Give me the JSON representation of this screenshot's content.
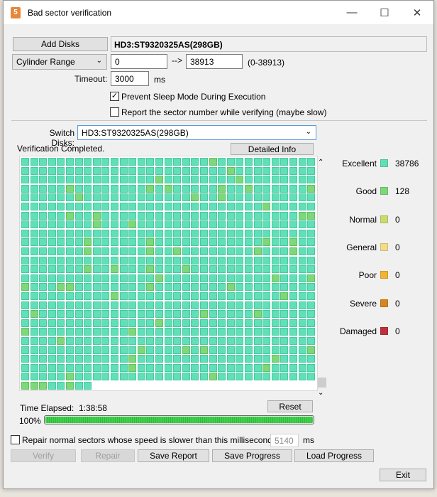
{
  "window": {
    "title": "Bad sector verification"
  },
  "top": {
    "add_disks": "Add Disks",
    "disk_name": "HD3:ST9320325AS(298GB)",
    "range_mode": "Cylinder Range",
    "range_from": "0",
    "arrow": "-->",
    "range_to": "38913",
    "range_hint": "(0-38913)",
    "timeout_label": "Timeout:",
    "timeout_value": "3000",
    "timeout_unit": "ms",
    "prevent_sleep": "Prevent Sleep Mode During Execution",
    "prevent_sleep_checked": true,
    "report_sector": "Report the sector number while verifying (maybe slow)",
    "report_sector_checked": false
  },
  "main": {
    "switch_label": "Switch Disks:",
    "switch_value": "HD3:ST9320325AS(298GB)",
    "status": "Verification Completed.",
    "detailed_info": "Detailed Info",
    "time_label": "Time Elapsed:",
    "time_value": "1:38:58",
    "reset": "Reset",
    "progress_text": "100%",
    "progress": 100
  },
  "legend": [
    {
      "label": "Excellent",
      "color": "#5fe0b8",
      "count": "38786"
    },
    {
      "label": "Good",
      "color": "#7cd87a",
      "count": "128"
    },
    {
      "label": "Normal",
      "color": "#c8dc6e",
      "count": "0"
    },
    {
      "label": "General",
      "color": "#f2dc8a",
      "count": "0"
    },
    {
      "label": "Poor",
      "color": "#f2b430",
      "count": "0"
    },
    {
      "label": "Severe",
      "color": "#d8861c",
      "count": "0"
    },
    {
      "label": "Damaged",
      "color": "#c0303a",
      "count": "0"
    }
  ],
  "bottom": {
    "repair_label": "Repair normal sectors whose speed is slower than this millisecond:",
    "repair_checked": false,
    "repair_ms": "5140",
    "repair_unit": "ms",
    "verify": "Verify",
    "repair": "Repair",
    "save_report": "Save Report",
    "save_progress": "Save Progress",
    "load_progress": "Load Progress",
    "exit": "Exit"
  }
}
